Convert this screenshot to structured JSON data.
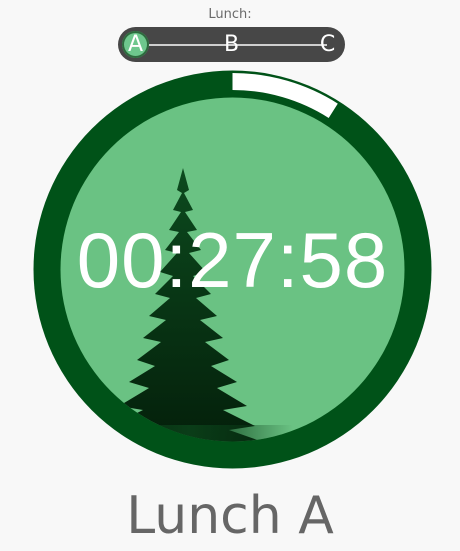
{
  "selector": {
    "label": "Lunch:",
    "options": [
      "A",
      "B",
      "C"
    ],
    "selected": "A"
  },
  "timer": {
    "time": "00:27:58",
    "progress": 0.09
  },
  "period": {
    "title": "Lunch A"
  },
  "colors": {
    "ring": "#005218",
    "fill": "#6ac283",
    "progress": "#ffffff",
    "tree": "#0a3d18",
    "slider_bg": "#474747",
    "active_stop": "#6ec78d"
  },
  "icons": {
    "center_art": "pine-tree-icon"
  }
}
